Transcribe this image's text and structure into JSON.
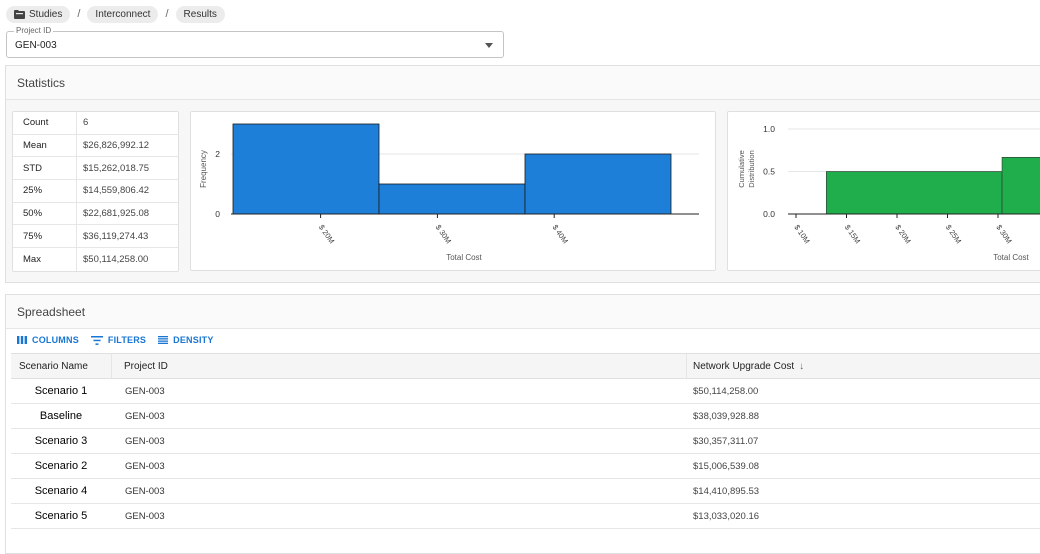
{
  "breadcrumb": {
    "items": [
      "Studies",
      "Interconnect",
      "Results"
    ],
    "separator": "/"
  },
  "project_select": {
    "legend": "Project ID",
    "value": "GEN-003"
  },
  "statistics": {
    "title": "Statistics",
    "rows": [
      {
        "label": "Count",
        "value": "6"
      },
      {
        "label": "Mean",
        "value": "$26,826,992.12"
      },
      {
        "label": "STD",
        "value": "$15,262,018.75"
      },
      {
        "label": "25%",
        "value": "$14,559,806.42"
      },
      {
        "label": "50%",
        "value": "$22,681,925.08"
      },
      {
        "label": "75%",
        "value": "$36,119,274.43"
      },
      {
        "label": "Max",
        "value": "$50,114,258.00"
      }
    ]
  },
  "chart_data": [
    {
      "type": "bar",
      "title": "",
      "xlabel": "Total Cost",
      "ylabel": "Frequency",
      "x_ticks": [
        "$ 20M",
        "$ 30M",
        "$ 40M"
      ],
      "y_ticks": [
        "0",
        "2"
      ],
      "ylim": [
        0,
        3
      ],
      "bins": [
        {
          "x0": 12.5,
          "x1": 25,
          "count": 3
        },
        {
          "x0": 25,
          "x1": 37.5,
          "count": 1
        },
        {
          "x0": 37.5,
          "x1": 50,
          "count": 2
        }
      ],
      "x_units": "$M",
      "color": "#1e7fd9"
    },
    {
      "type": "area",
      "title": "",
      "xlabel": "Total Cost",
      "ylabel": "Cumulative Distribution",
      "x_ticks": [
        "$ 10M",
        "$ 15M",
        "$ 20M",
        "$ 25M",
        "$ 30M"
      ],
      "y_ticks": [
        "0.0",
        "0.5",
        "1.0"
      ],
      "ylim": [
        0,
        1
      ],
      "x_units": "$M",
      "steps": [
        {
          "x": 8,
          "y": 0.0
        },
        {
          "x": 13.0,
          "y": 0.5
        },
        {
          "x": 30.4,
          "y": 0.667
        },
        {
          "x": 36,
          "y": 0.667
        }
      ],
      "color": "#1fae4b"
    }
  ],
  "spreadsheet": {
    "title": "Spreadsheet",
    "toolbar": {
      "columns": "COLUMNS",
      "filters": "FILTERS",
      "density": "DENSITY"
    },
    "headers": {
      "scenario": "Scenario Name",
      "project": "Project ID",
      "cost": "Network Upgrade Cost",
      "sort": "↓"
    },
    "rows": [
      {
        "scenario": "Scenario 1",
        "project": "GEN-003",
        "cost": "$50,114,258.00"
      },
      {
        "scenario": "Baseline",
        "project": "GEN-003",
        "cost": "$38,039,928.88"
      },
      {
        "scenario": "Scenario 3",
        "project": "GEN-003",
        "cost": "$30,357,311.07"
      },
      {
        "scenario": "Scenario 2",
        "project": "GEN-003",
        "cost": "$15,006,539.08"
      },
      {
        "scenario": "Scenario 4",
        "project": "GEN-003",
        "cost": "$14,410,895.53"
      },
      {
        "scenario": "Scenario 5",
        "project": "GEN-003",
        "cost": "$13,033,020.16"
      }
    ]
  }
}
